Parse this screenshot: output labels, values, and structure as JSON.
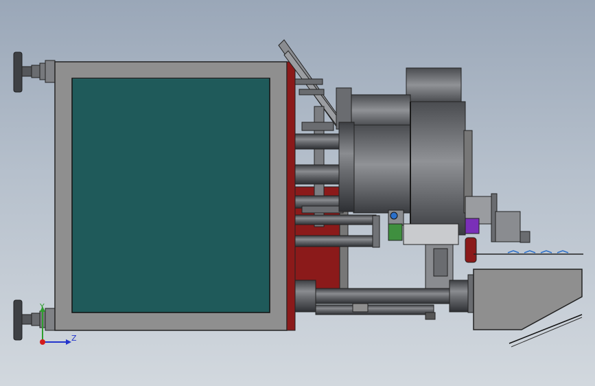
{
  "view": {
    "background_top": "#9aa7b8",
    "background_bottom": "#d2d8de"
  },
  "triad": {
    "y_label": "Y",
    "z_label": "Z",
    "y_color": "#2e9e2e",
    "z_color": "#2233cc",
    "origin_color": "#d41c1c"
  },
  "palette": {
    "frame": "#8f8f8f",
    "panel": "#1f5a5a",
    "red_plate": "#8b1a1a",
    "steel": "#5a5c60",
    "purple": "#7a2fb8",
    "green": "#3f8f3f",
    "blue": "#2a6fc9"
  }
}
